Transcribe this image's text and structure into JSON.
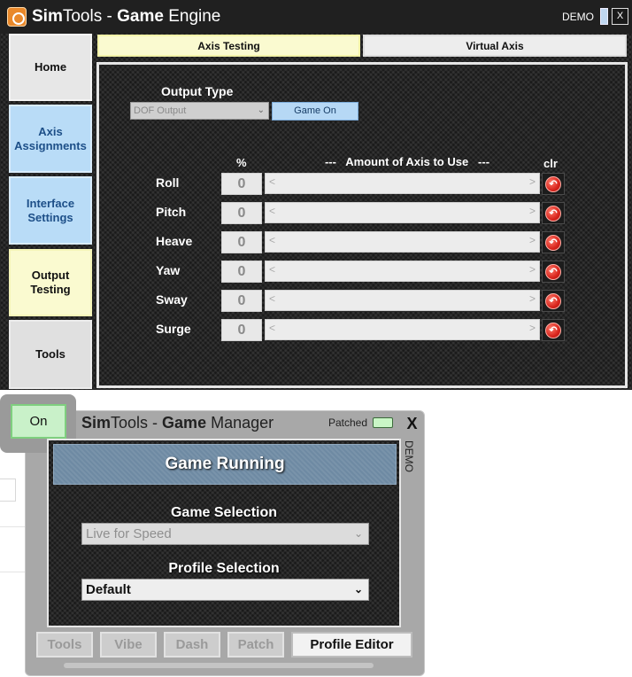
{
  "engine": {
    "title_prefix": "Sim",
    "title_tools": "Tools - ",
    "title_game": "Game",
    "title_rest": " Engine",
    "demo_label": "DEMO",
    "close_label": "X",
    "nav": {
      "home": "Home",
      "axis_assignments": "Axis Assignments",
      "interface_settings": "Interface Settings",
      "output_testing": "Output Testing",
      "tools": "Tools"
    },
    "tabs": {
      "axis_testing": "Axis Testing",
      "virtual_axis": "Virtual Axis"
    },
    "output_type_label": "Output Type",
    "output_type_value": "DOF Output",
    "game_on_label": "Game On",
    "headers": {
      "percent": "%",
      "amount": "---   Amount of Axis to Use   ---",
      "clr": "clr"
    },
    "axes": [
      {
        "name": "Roll",
        "value": "0"
      },
      {
        "name": "Pitch",
        "value": "0"
      },
      {
        "name": "Heave",
        "value": "0"
      },
      {
        "name": "Yaw",
        "value": "0"
      },
      {
        "name": "Sway",
        "value": "0"
      },
      {
        "name": "Surge",
        "value": "0"
      }
    ],
    "slider_left": "<",
    "slider_right": ">"
  },
  "manager": {
    "on_label": "On",
    "title_sim": "Sim",
    "title_tools": "Tools - ",
    "title_game": "Game",
    "title_rest": " Manager",
    "patched_label": "Patched",
    "close_label": "X",
    "demo_label": "DEMO",
    "status": "Game Running",
    "game_selection_label": "Game Selection",
    "game_selection_value": "Live for Speed",
    "profile_selection_label": "Profile Selection",
    "profile_selection_value": "Default",
    "buttons": {
      "tools": "Tools",
      "vibe": "Vibe",
      "dash": "Dash",
      "patch": "Patch",
      "profile_editor": "Profile Editor"
    }
  },
  "colors": {
    "accent_blue": "#b9dcf7",
    "active_yellow": "#fafad0",
    "on_green": "#c9f1c9",
    "clear_red": "#d8241c"
  }
}
